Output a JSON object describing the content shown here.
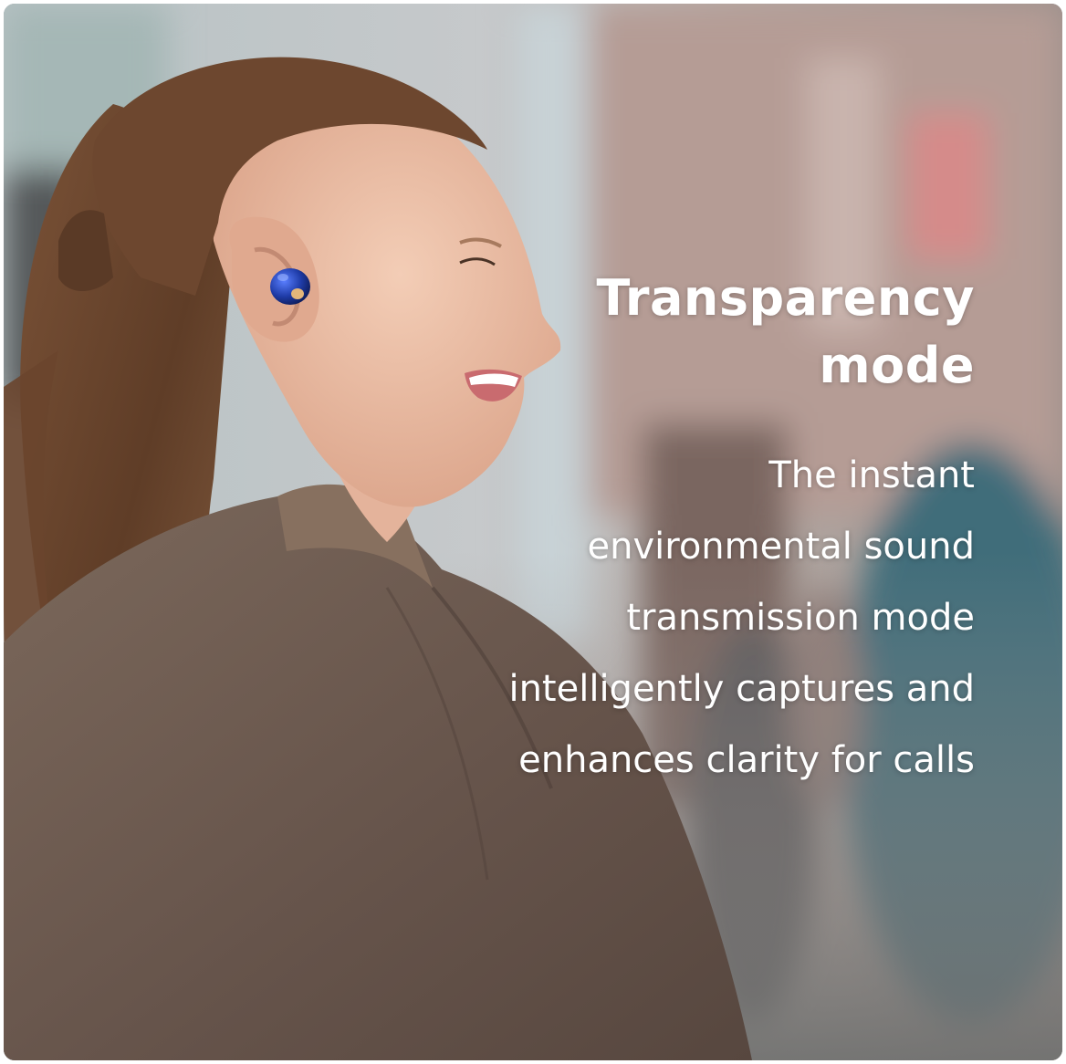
{
  "headline": {
    "line1": "Transparency",
    "line2": "mode"
  },
  "body": {
    "line1": "The instant",
    "line2": "environmental sound",
    "line3": "transmission mode",
    "line4": "intelligently captures and",
    "line5": "enhances clarity for calls"
  },
  "colors": {
    "text": "#ffffff",
    "jacket": "#6b574a",
    "hair": "#6e4a33",
    "earbud": "#1e3fa8",
    "background_blur": "#a9a6a4"
  },
  "icons": {
    "earbud": "earbud-icon"
  }
}
